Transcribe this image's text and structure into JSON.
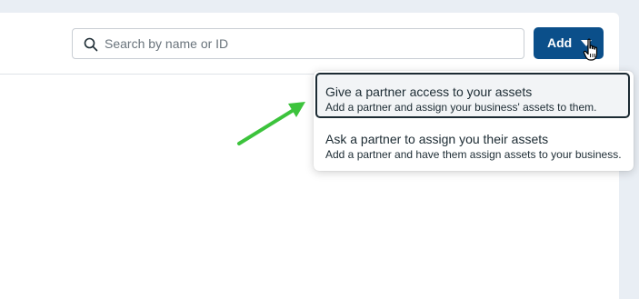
{
  "search": {
    "placeholder": "Search by name or ID",
    "value": "",
    "icon": "search-icon"
  },
  "toolbar": {
    "add_label": "Add",
    "add_color": "#0b4f8a"
  },
  "dropdown": {
    "items": [
      {
        "title": "Give a partner access to your assets",
        "description": "Add a partner and assign your business' assets to them.",
        "selected": true
      },
      {
        "title": "Ask a partner to assign you their assets",
        "description": "Add a partner and have them assign assets to your business.",
        "selected": false
      }
    ]
  },
  "annotation": {
    "arrow_color": "#3cc33c"
  }
}
